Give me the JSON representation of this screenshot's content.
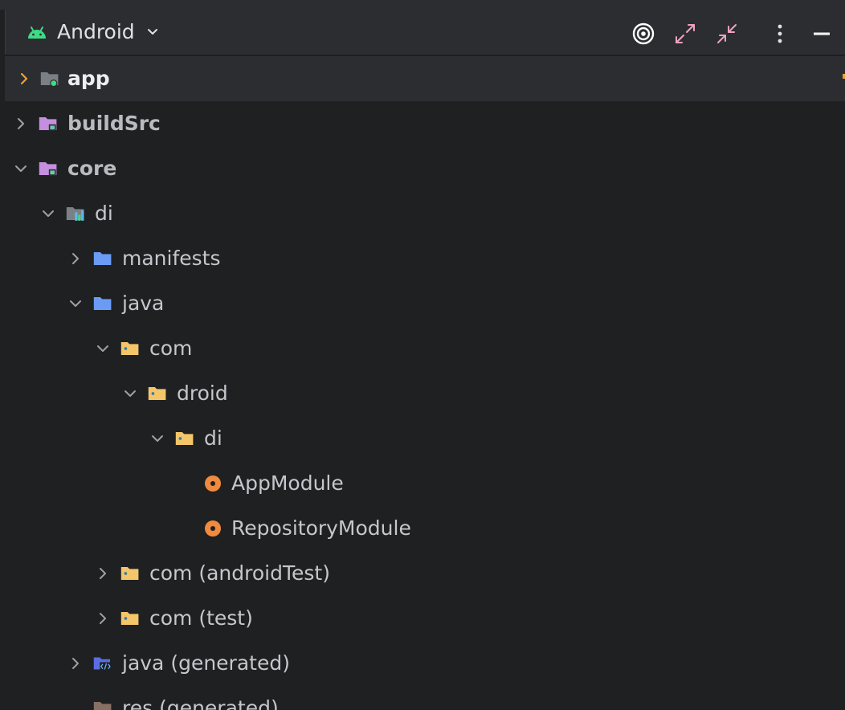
{
  "header": {
    "view_label": "Android",
    "accent_android": "#3ddc84",
    "accent_expand": "#f2a1c0"
  },
  "toolbar_icons": [
    "locate-target-icon",
    "expand-all-icon",
    "collapse-all-icon",
    "more-options-icon",
    "minimize-icon"
  ],
  "tree": {
    "rows": [
      {
        "label": "app",
        "icon": "module-folder-icon",
        "state": "collapsed",
        "selected": true
      },
      {
        "label": "buildSrc",
        "icon": "module-folder-icon",
        "state": "collapsed"
      },
      {
        "label": "core",
        "icon": "module-folder-icon",
        "state": "expanded"
      },
      {
        "label": "di",
        "icon": "library-module-icon",
        "state": "expanded"
      },
      {
        "label": "manifests",
        "icon": "folder-icon",
        "state": "collapsed"
      },
      {
        "label": "java",
        "icon": "folder-icon",
        "state": "expanded"
      },
      {
        "label": "com",
        "icon": "package-folder-icon",
        "state": "expanded"
      },
      {
        "label": "droid",
        "icon": "package-folder-icon",
        "state": "expanded"
      },
      {
        "label": "di",
        "icon": "package-folder-icon",
        "state": "expanded"
      },
      {
        "label": "AppModule",
        "icon": "class-icon"
      },
      {
        "label": "RepositoryModule",
        "icon": "class-icon"
      },
      {
        "label": "com (androidTest)",
        "icon": "package-folder-icon",
        "state": "collapsed"
      },
      {
        "label": "com (test)",
        "icon": "package-folder-icon",
        "state": "collapsed"
      },
      {
        "label": "java (generated)",
        "icon": "generated-source-folder-icon",
        "state": "collapsed"
      },
      {
        "label": "res (generated)",
        "icon": "resource-folder-icon",
        "state": "collapsed"
      }
    ]
  }
}
